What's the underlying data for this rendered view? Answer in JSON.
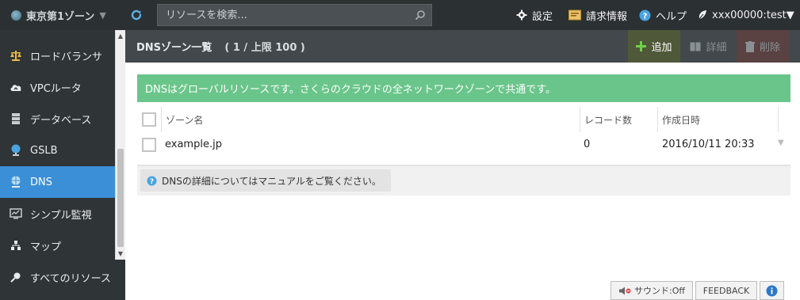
{
  "topbar": {
    "zone_label": "東京第1ゾーン",
    "search_placeholder": "リソースを検索...",
    "settings_label": "設定",
    "billing_label": "請求情報",
    "help_label": "ヘルプ",
    "user_label": "xxx00000:test▼"
  },
  "sidebar": {
    "items": [
      {
        "label": "ロードバランサ",
        "icon": "scale-icon"
      },
      {
        "label": "VPCルータ",
        "icon": "cloud-icon"
      },
      {
        "label": "データベース",
        "icon": "database-icon"
      },
      {
        "label": "GSLB",
        "icon": "globe-icon"
      },
      {
        "label": "DNS",
        "icon": "dns-icon",
        "active": true
      },
      {
        "label": "シンプル監視",
        "icon": "monitor-icon"
      },
      {
        "label": "マップ",
        "icon": "map-icon"
      },
      {
        "label": "すべてのリソース",
        "icon": "search-icon"
      }
    ]
  },
  "main": {
    "title": "DNSゾーン一覧",
    "count": "( 1 / 上限 100 )",
    "buttons": {
      "add": "追加",
      "detail": "詳細",
      "delete": "削除"
    },
    "info_message": "DNSはグローバルリソースです。さくらのクラウドの全ネットワークゾーンで共通です。",
    "table": {
      "headers": [
        "ゾーン名",
        "レコード数",
        "作成日時"
      ],
      "rows": [
        {
          "zone": "example.jp",
          "records": "0",
          "created": "2016/10/11 20:33"
        }
      ]
    },
    "manual_note": "DNSの詳細についてはマニュアルをご覧ください。"
  },
  "footer": {
    "sound_label": "サウンド:Off",
    "feedback_label": "FEEDBACK"
  },
  "colors": {
    "accent": "#3b8fd6",
    "info_green": "#6ac58a",
    "topbar": "#2b3033",
    "sidebar": "#2f3437"
  }
}
